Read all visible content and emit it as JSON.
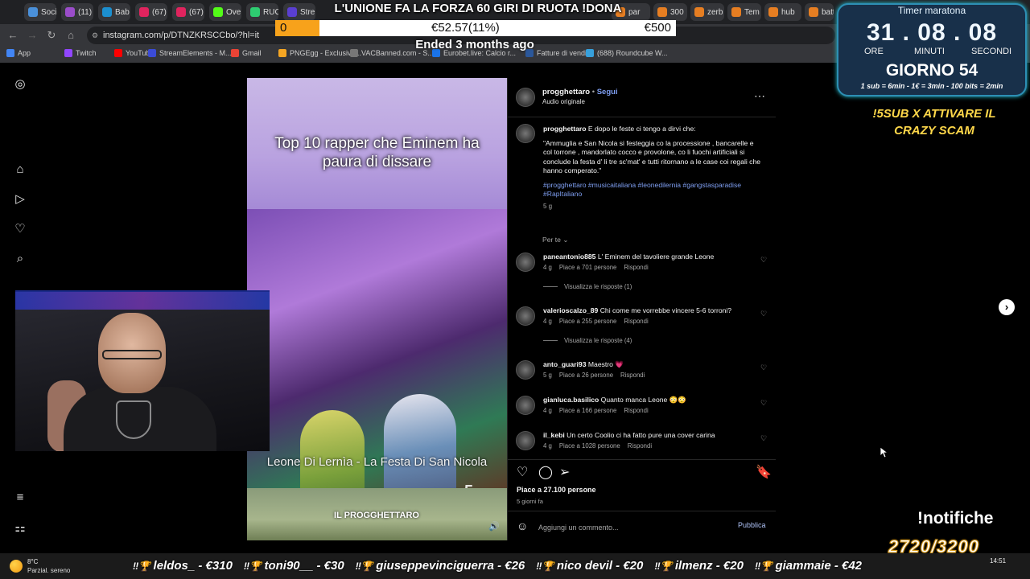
{
  "browser": {
    "tabs": [
      {
        "label": "Soci",
        "color": "#4a90d9"
      },
      {
        "label": "(11)",
        "color": "#9b4dca"
      },
      {
        "label": "Bab",
        "color": "#1c8fcf"
      },
      {
        "label": "(67)",
        "color": "#e0245e"
      },
      {
        "label": "(67)",
        "color": "#e0245e"
      },
      {
        "label": "Ove",
        "color": "#53fc18"
      },
      {
        "label": "RUC",
        "color": "#2ecc71"
      },
      {
        "label": "Stre",
        "color": "#5a3fd1"
      },
      {
        "label": "par",
        "color": "#e67e22"
      },
      {
        "label": "300",
        "color": "#e67e22"
      },
      {
        "label": "zerb",
        "color": "#e67e22"
      },
      {
        "label": "Tem",
        "color": "#e67e22"
      },
      {
        "label": "hub",
        "color": "#e67e22"
      },
      {
        "label": "batt",
        "color": "#e67e22"
      }
    ],
    "url": "instagram.com/p/DTNZKRSCCbo/?hl=it",
    "bookmarks": [
      {
        "label": "App",
        "color": "#4285f4"
      },
      {
        "label": "Twitch",
        "color": "#9146ff"
      },
      {
        "label": "YouTube",
        "color": "#ff0000"
      },
      {
        "label": "StreamElements - M...",
        "color": "#3b4bd6"
      },
      {
        "label": "Gmail",
        "color": "#ea4335"
      },
      {
        "label": "PNGEgg - Exclusive...",
        "color": "#f5a623"
      },
      {
        "label": "VACBanned.com - S...",
        "color": "#777777"
      },
      {
        "label": "Eurobet.live: Calcio r...",
        "color": "#1a73e8"
      },
      {
        "label": "Fatture di vendita",
        "color": "#2b579a"
      },
      {
        "label": "(688) Roundcube W...",
        "color": "#37a0dc"
      }
    ]
  },
  "goal": {
    "title": "L'UNIONE FA LA FORZA 60 GIRI DI RUOTA !DONA",
    "start": "0",
    "current": "€52.57(11%)",
    "target": "€500",
    "progress": 0.11,
    "status": "Ended 3 months ago"
  },
  "reel": {
    "caption": "Top 10 rapper che Eminem ha paura di dissare",
    "subtitle": "Leone Di Lernìa - La Festa Di San Nicola",
    "logo": "IL PROGGHETTARO",
    "broadcaster": "5"
  },
  "post": {
    "username": "progghettaro",
    "follow": "Segui",
    "audio": "Audio originale",
    "caption_intro": "E dopo le feste ci tengo a dirvi che:",
    "caption_quote": "\"Ammuglia e San Nicola si festeggia co la processione , bancarelle e col torrone , mandorlato cocco e provolone, co li fuochi artificiali si conclude la festa d' li tre sc'mat' e tutti ritornano a le case coi regali che hanno comperato.\"",
    "hashtags": "#progghettaro #musicaitaliana #leonedilernia #gangstasparadise #RapItaliano",
    "caption_age": "5 g",
    "see_translation": "Per te",
    "comments": [
      {
        "user": "paneantonio885",
        "text": "L' Eminem del tavoliere grande Leone",
        "age": "4 g",
        "likes": "Piace a 701 persone",
        "reply": "Rispondi",
        "replies": "Visualizza le risposte (1)"
      },
      {
        "user": "valerioscalzo_89",
        "text": "Chi come me vorrebbe vincere 5-6 torroni?",
        "age": "4 g",
        "likes": "Piace a 255 persone",
        "reply": "Rispondi",
        "replies": "Visualizza le risposte (4)"
      },
      {
        "user": "anto_guari93",
        "text": "Maestro 💗",
        "age": "5 g",
        "likes": "Piace a 26 persone",
        "reply": "Rispondi",
        "replies": ""
      },
      {
        "user": "gianluca.basilico",
        "text": "Quanto manca Leone 😳😳",
        "age": "4 g",
        "likes": "Piace a 166 persone",
        "reply": "Rispondi",
        "replies": ""
      },
      {
        "user": "il_kebi",
        "text": "Un certo Coolio ci ha fatto pure una cover carina",
        "age": "4 g",
        "likes": "Piace a 1028 persone",
        "reply": "Rispondi",
        "replies": ""
      }
    ],
    "likes_total": "Piace a 27.100 persone",
    "posted": "5 giorni fa",
    "comment_placeholder": "Aggiungi un commento...",
    "publish": "Pubblica"
  },
  "timer": {
    "title": "Timer maratona",
    "digits": "31 . 08 . 08",
    "hours_label": "ORE",
    "minutes_label": "MINUTI",
    "seconds_label": "SECONDI",
    "day": "GIORNO 54",
    "rates": "1 sub = 6min - 1€ = 3min - 100 bits = 2min"
  },
  "overlay": {
    "sub_note": "!5SUB X ATTIVARE IL CRAZY SCAM",
    "notifiche": "!notifiche",
    "notif_count": "2720/3200"
  },
  "taskbar": {
    "temp": "8°C",
    "weather": "Parzial. sereno",
    "clock": "14:51",
    "ticker": [
      "leldos_ - €310",
      "toni90__ - €30",
      "giuseppevinciguerra - €26",
      "nico devil - €20",
      "ilmenz - €20",
      "giammaie - €42"
    ]
  },
  "colors": {
    "accent_link": "#7f9ff2",
    "goal_fill": "#f7a21b",
    "timer_border": "#2d8fb4",
    "sub_note": "#ffd84a"
  }
}
